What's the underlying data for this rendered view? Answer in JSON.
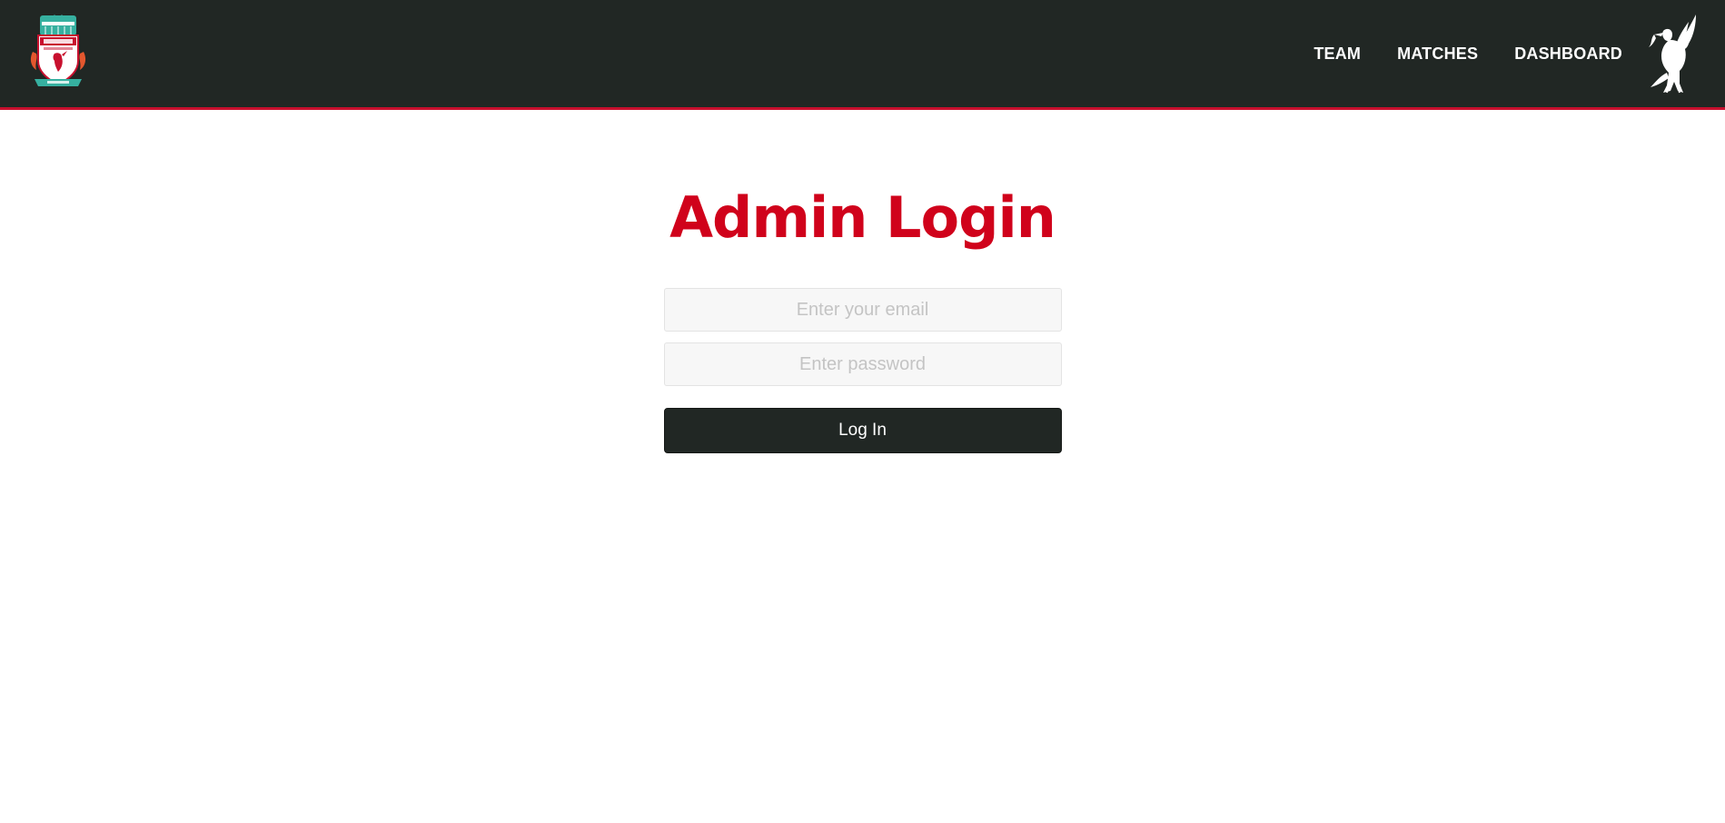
{
  "header": {
    "logo_icon": "lfc-crest-icon",
    "emblem_icon": "liverbird-icon",
    "nav": [
      {
        "label": "TEAM"
      },
      {
        "label": "MATCHES"
      },
      {
        "label": "DASHBOARD"
      }
    ],
    "colors": {
      "bar": "#212724",
      "accent": "#c8102e"
    }
  },
  "login": {
    "title": "Admin Login",
    "email_placeholder": "Enter your email",
    "email_value": "",
    "password_placeholder": "Enter password",
    "password_value": "",
    "submit_label": "Log In",
    "colors": {
      "title": "#d0021b",
      "button": "#212724"
    }
  }
}
